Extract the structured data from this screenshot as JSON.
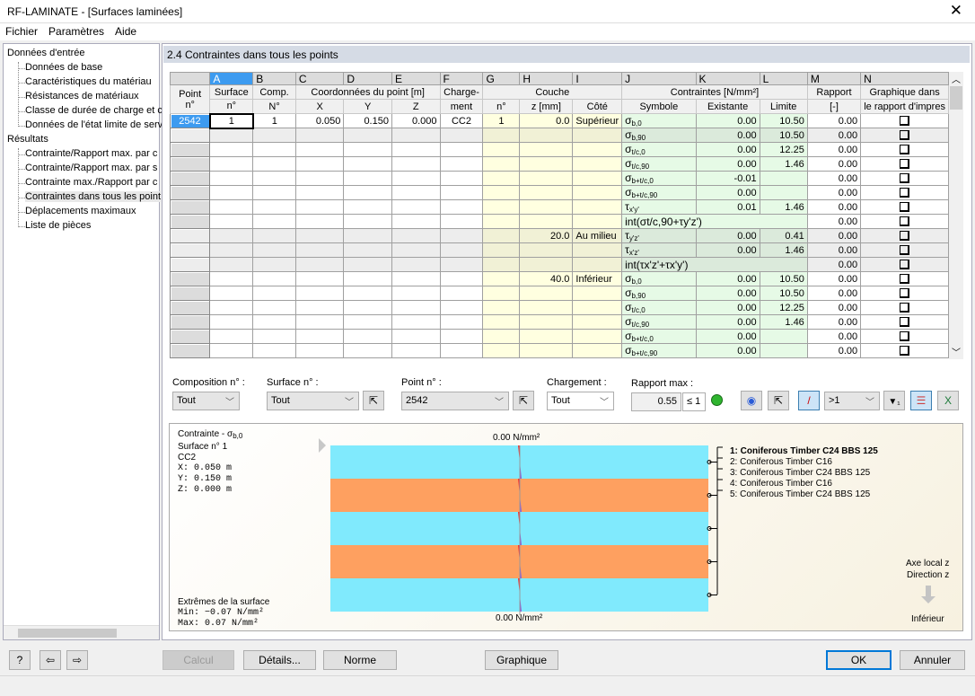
{
  "window": {
    "title": "RF-LAMINATE - [Surfaces laminées]",
    "close_icon": "close-icon"
  },
  "menu": [
    "Fichier",
    "Paramètres",
    "Aide"
  ],
  "tree": {
    "input_label": "Données d'entrée",
    "input_items": [
      "Données de base",
      "Caractéristiques du matériau",
      "Résistances de matériaux",
      "Classe de durée de charge et c",
      "Données de l'état limite de serv"
    ],
    "results_label": "Résultats",
    "results_items": [
      "Contrainte/Rapport max. par c",
      "Contrainte/Rapport max. par s",
      "Contrainte max./Rapport par c",
      "Contraintes dans tous les point",
      "Déplacements maximaux",
      "Liste de pièces"
    ],
    "selected": "Contraintes dans tous les point"
  },
  "section_title": "2.4 Contraintes dans tous les points",
  "table": {
    "letters": [
      "A",
      "B",
      "C",
      "D",
      "E",
      "F",
      "G",
      "H",
      "I",
      "J",
      "K",
      "L",
      "M",
      "N"
    ],
    "headers": {
      "point": [
        "Point",
        "n°"
      ],
      "surface": [
        "Surface",
        "n°"
      ],
      "comp": [
        "Comp.",
        "N°"
      ],
      "coords": "Coordonnées du point [m]",
      "x": "X",
      "y": "Y",
      "z": "Z",
      "loading": [
        "Charge-",
        "ment"
      ],
      "layer": "Couche",
      "layer_no": "n°",
      "layer_z": "z [mm]",
      "side": "Côté",
      "stresses": "Contraintes [N/mm²]",
      "symbol": "Symbole",
      "existing": "Existante",
      "limit": "Limite",
      "ratio": [
        "Rapport",
        "[-]"
      ],
      "graph": [
        "Graphique dans",
        "le rapport d'impres"
      ]
    },
    "rows": [
      {
        "point": "2542",
        "surface": "1",
        "comp": "1",
        "x": "0.050",
        "y": "0.150",
        "z": "0.000",
        "load": "CC2",
        "layer": "1",
        "lz": "0.0",
        "side": "Supérieur",
        "sym": "σ",
        "sub": "b,0",
        "exist": "0.00",
        "limit": "10.50",
        "ratio": "0.00",
        "checked": false
      },
      {
        "sym": "σ",
        "sub": "b,90",
        "exist": "0.00",
        "limit": "10.50",
        "ratio": "0.00",
        "checked": false,
        "shaded": true
      },
      {
        "sym": "σ",
        "sub": "t/c,0",
        "exist": "0.00",
        "limit": "12.25",
        "ratio": "0.00",
        "checked": false
      },
      {
        "sym": "σ",
        "sub": "t/c,90",
        "exist": "0.00",
        "limit": "1.46",
        "ratio": "0.00",
        "checked": false
      },
      {
        "sym": "σ",
        "sub": "b+t/c,0",
        "exist": "-0.01",
        "limit": "",
        "ratio": "0.00",
        "checked": false
      },
      {
        "sym": "σ",
        "sub": "b+t/c,90",
        "exist": "0.00",
        "limit": "",
        "ratio": "0.00",
        "checked": false
      },
      {
        "sym": "τ",
        "sub": "x'y'",
        "exist": "0.01",
        "limit": "1.46",
        "ratio": "0.00",
        "checked": false
      },
      {
        "int": "int(σt/c,90+τy'z')",
        "ratio": "0.00",
        "checked": false
      },
      {
        "lz": "20.0",
        "side": "Au milieu",
        "sym": "τ",
        "sub": "y'z'",
        "exist": "0.00",
        "limit": "0.41",
        "ratio": "0.00",
        "checked": false,
        "shaded": true
      },
      {
        "sym": "τ",
        "sub": "x'z'",
        "exist": "0.00",
        "limit": "1.46",
        "ratio": "0.00",
        "checked": false,
        "shaded": true
      },
      {
        "int": "int(τx'z'+τx'y')",
        "ratio": "0.00",
        "checked": false,
        "shaded": true
      },
      {
        "lz": "40.0",
        "side": "Inférieur",
        "sym": "σ",
        "sub": "b,0",
        "exist": "0.00",
        "limit": "10.50",
        "ratio": "0.00",
        "checked": false
      },
      {
        "sym": "σ",
        "sub": "b,90",
        "exist": "0.00",
        "limit": "10.50",
        "ratio": "0.00",
        "checked": false
      },
      {
        "sym": "σ",
        "sub": "t/c,0",
        "exist": "0.00",
        "limit": "12.25",
        "ratio": "0.00",
        "checked": false
      },
      {
        "sym": "σ",
        "sub": "t/c,90",
        "exist": "0.00",
        "limit": "1.46",
        "ratio": "0.00",
        "checked": false
      },
      {
        "sym": "σ",
        "sub": "b+t/c,0",
        "exist": "0.00",
        "limit": "",
        "ratio": "0.00",
        "checked": false
      },
      {
        "sym": "σ",
        "sub": "b+t/c,90",
        "exist": "0.00",
        "limit": "",
        "ratio": "0.00",
        "checked": false
      }
    ]
  },
  "filters": {
    "composition_label": "Composition n° :",
    "composition_value": "Tout",
    "surface_label": "Surface n° :",
    "surface_value": "Tout",
    "point_label": "Point n° :",
    "point_value": "2542",
    "loading_label": "Chargement :",
    "loading_value": "Tout",
    "ratio_label": "Rapport max :",
    "ratio_value": "0.55",
    "ratio_limit": "≤ 1",
    "filter_value": ">1"
  },
  "graphic": {
    "stress_label": "Contrainte - σ",
    "stress_sub": "b,0",
    "surface": "Surface n° 1",
    "loading": "CC2",
    "x": "X: 0.050  m",
    "y": "Y: 0.150  m",
    "z": "Z: 0.000  m",
    "top_value": "0.00 N/mm²",
    "bottom_value": "0.00 N/mm²",
    "extremes_label": "Extrêmes de la surface",
    "min": "Min:  −0.07 N/mm²",
    "max": "Max:   0.07 N/mm²",
    "layers": [
      "1: Coniferous Timber C24 BBS 125",
      "2: Coniferous Timber C16",
      "3: Coniferous Timber C24 BBS 125",
      "4: Coniferous Timber C16",
      "5: Coniferous Timber C24 BBS 125"
    ],
    "layer_colors": [
      "#80eafd",
      "#fea060",
      "#80eafd",
      "#fea060",
      "#80eafd"
    ],
    "axis1": "Axe local z",
    "axis2": "Direction z",
    "axis3": "Inférieur"
  },
  "buttons": {
    "calc": "Calcul",
    "details": "Détails...",
    "norm": "Norme",
    "graphic": "Graphique",
    "ok": "OK",
    "cancel": "Annuler"
  }
}
